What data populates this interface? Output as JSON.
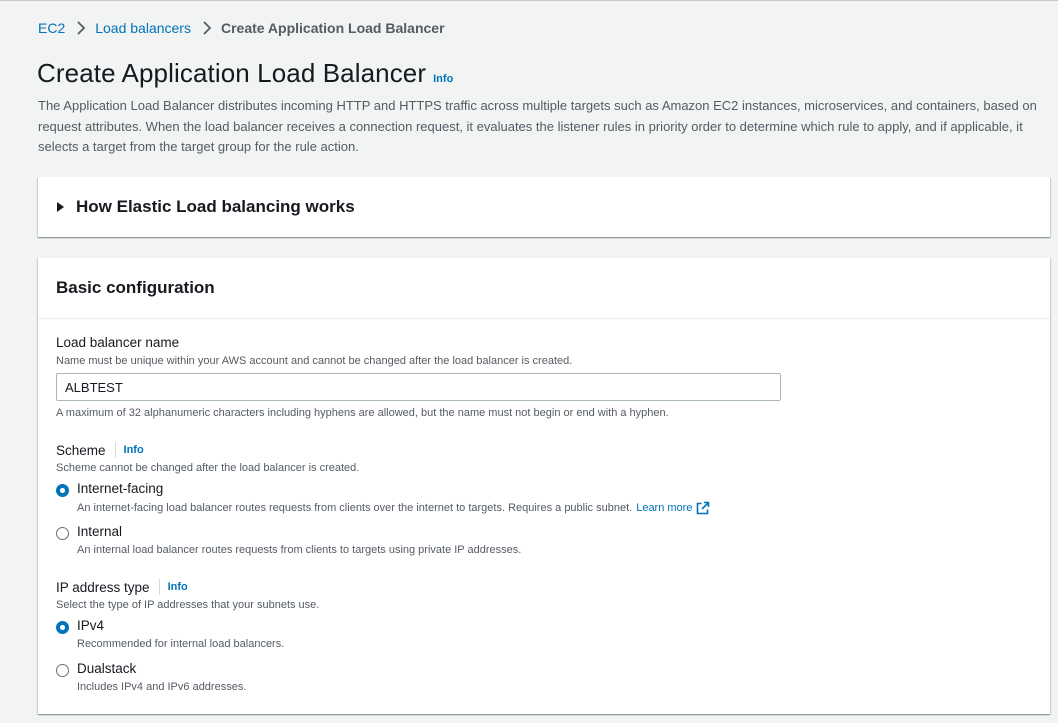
{
  "breadcrumb": {
    "items": [
      "EC2",
      "Load balancers"
    ],
    "current": "Create Application Load Balancer"
  },
  "header": {
    "title": "Create Application Load Balancer",
    "info": "Info",
    "description": "The Application Load Balancer distributes incoming HTTP and HTTPS traffic across multiple targets such as Amazon EC2 instances, microservices, and containers, based on request attributes. When the load balancer receives a connection request, it evaluates the listener rules in priority order to determine which rule to apply, and if applicable, it selects a target from the target group for the rule action."
  },
  "expander": {
    "label": "How Elastic Load balancing works"
  },
  "basic_config": {
    "title": "Basic configuration",
    "name": {
      "label": "Load balancer name",
      "description": "Name must be unique within your AWS account and cannot be changed after the load balancer is created.",
      "value": "ALBTEST",
      "constraint": "A maximum of 32 alphanumeric characters including hyphens are allowed, but the name must not begin or end with a hyphen."
    },
    "scheme": {
      "label": "Scheme",
      "info": "Info",
      "description": "Scheme cannot be changed after the load balancer is created.",
      "options": [
        {
          "label": "Internet-facing",
          "description": "An internet-facing load balancer routes requests from clients over the internet to targets. Requires a public subnet.",
          "learn_more": "Learn more",
          "selected": true
        },
        {
          "label": "Internal",
          "description": "An internal load balancer routes requests from clients to targets using private IP addresses.",
          "selected": false
        }
      ]
    },
    "ip_type": {
      "label": "IP address type",
      "info": "Info",
      "description": "Select the type of IP addresses that your subnets use.",
      "options": [
        {
          "label": "IPv4",
          "description": "Recommended for internal load balancers.",
          "selected": true
        },
        {
          "label": "Dualstack",
          "description": "Includes IPv4 and IPv6 addresses.",
          "selected": false
        }
      ]
    }
  },
  "colors": {
    "link": "#0073bb",
    "text": "#16191f",
    "muted": "#545b64",
    "background": "#f2f3f3"
  },
  "icons": {
    "breadcrumb_separator": "chevron-right-icon",
    "expander": "caret-right-icon",
    "external": "external-link-icon"
  }
}
